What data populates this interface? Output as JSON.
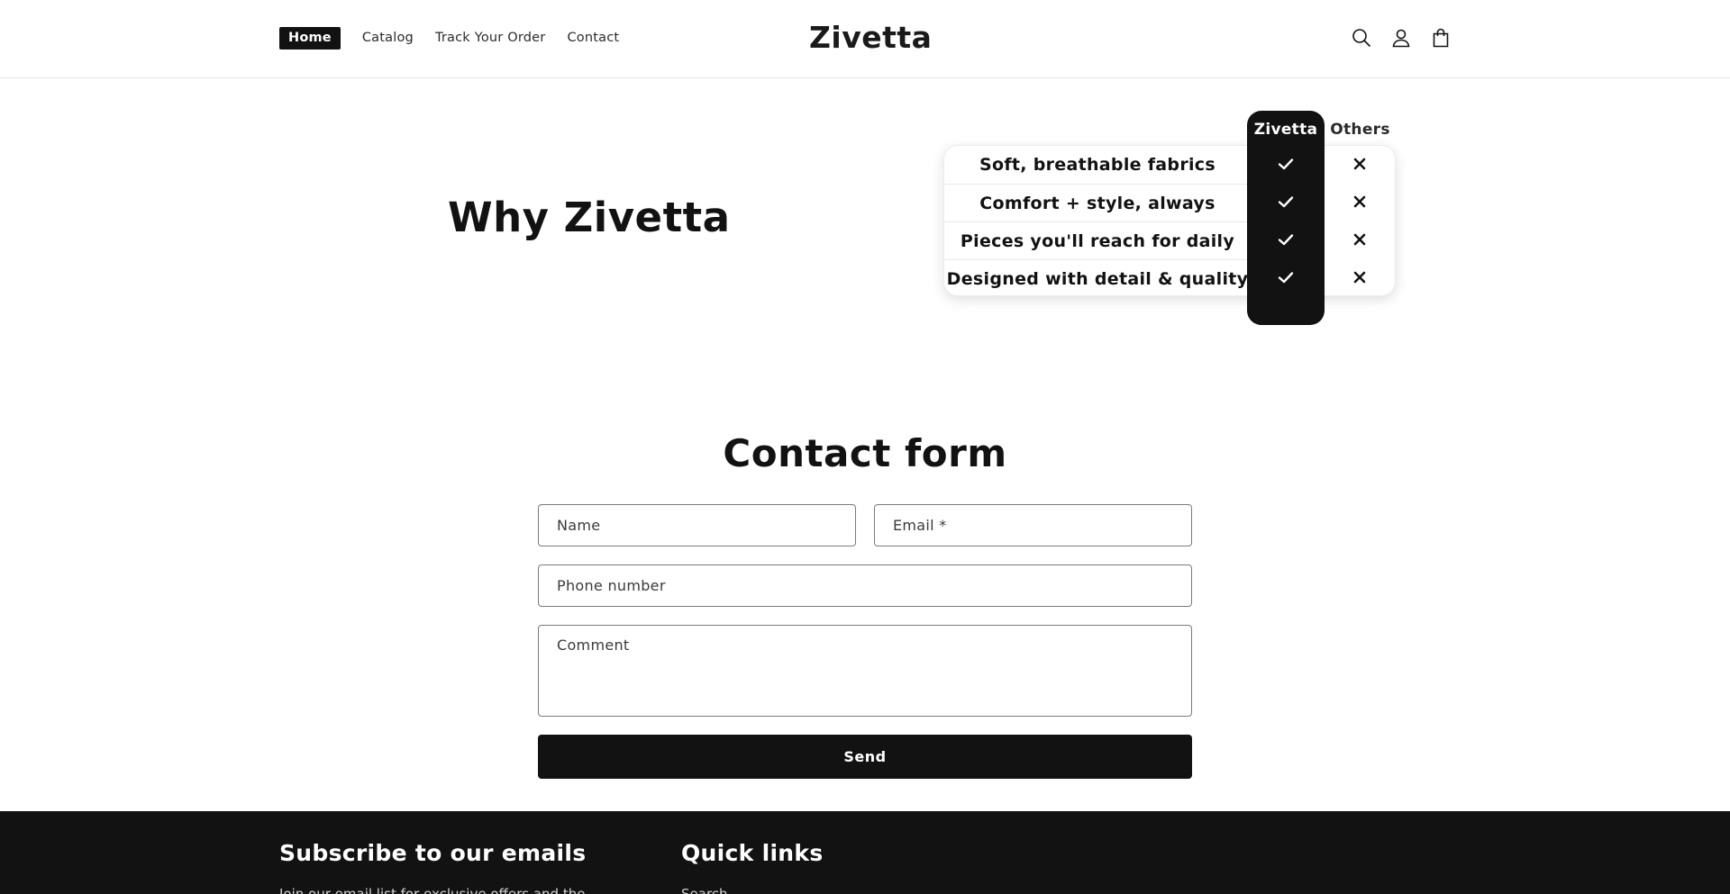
{
  "header": {
    "nav": [
      "Home",
      "Catalog",
      "Track Your Order",
      "Contact"
    ],
    "logo": "Zivetta",
    "icons": [
      "search-icon",
      "account-icon",
      "cart-icon"
    ]
  },
  "why": {
    "title": "Why Zivetta",
    "columns": {
      "brand": "Zivetta",
      "others": "Others"
    },
    "rows": [
      {
        "label": "Soft, breathable fabrics",
        "brand": true,
        "others": false
      },
      {
        "label": "Comfort + style, always",
        "brand": true,
        "others": false
      },
      {
        "label": "Pieces you'll reach for daily",
        "brand": true,
        "others": false
      },
      {
        "label": "Designed with detail & quality",
        "brand": true,
        "others": false
      }
    ]
  },
  "contact": {
    "title": "Contact form",
    "name_placeholder": "Name",
    "email_placeholder": "Email *",
    "phone_placeholder": "Phone number",
    "comment_placeholder": "Comment",
    "send_label": "Send"
  },
  "footer": {
    "subscribe_title": "Subscribe to our emails",
    "subscribe_text": "Join our email list for exclusive offers and the",
    "quick_links_title": "Quick links",
    "quick_links_first": "Search"
  },
  "colors": {
    "primary": "#121212",
    "background": "#ffffff",
    "border": "#7a7a7a"
  }
}
